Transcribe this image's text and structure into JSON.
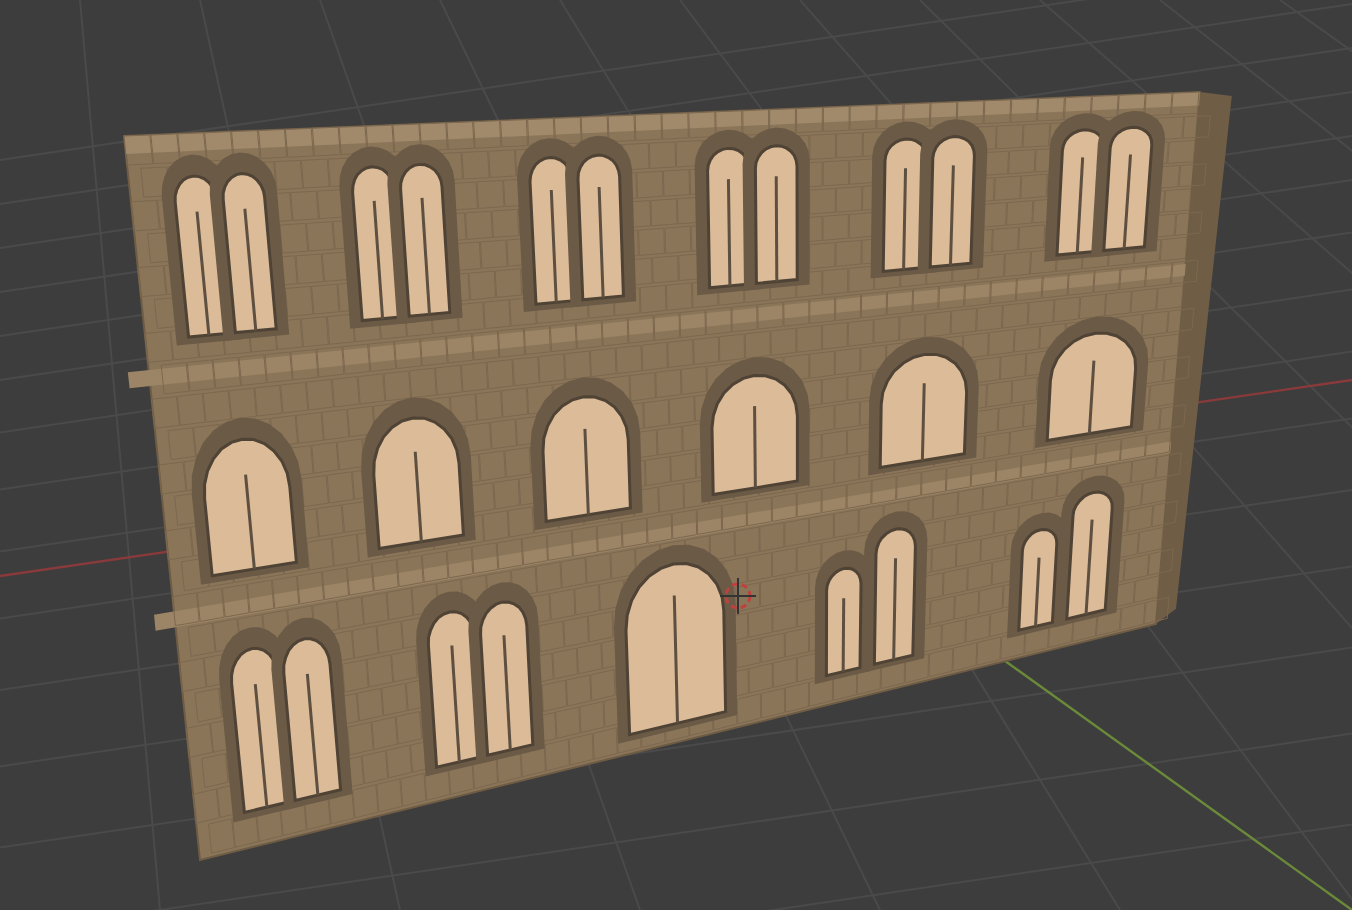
{
  "viewport": {
    "grid_visible": true,
    "x_axis_visible": true,
    "y_axis_visible": true,
    "cursor_visible": true
  },
  "facade": {
    "floors": [
      {
        "windows": [
          {
            "kind": "paired"
          },
          {
            "kind": "paired"
          },
          {
            "kind": "paired"
          },
          {
            "kind": "paired"
          },
          {
            "kind": "paired"
          },
          {
            "kind": "paired"
          }
        ]
      },
      {
        "windows": [
          {
            "kind": "single"
          },
          {
            "kind": "single"
          },
          {
            "kind": "single"
          },
          {
            "kind": "single"
          },
          {
            "kind": "single"
          },
          {
            "kind": "single"
          }
        ]
      },
      {
        "windows": [
          {
            "kind": "paired"
          },
          {
            "kind": "paired"
          },
          {
            "kind": "door"
          },
          {
            "kind": "twin"
          },
          {
            "kind": "twin"
          }
        ]
      }
    ]
  }
}
